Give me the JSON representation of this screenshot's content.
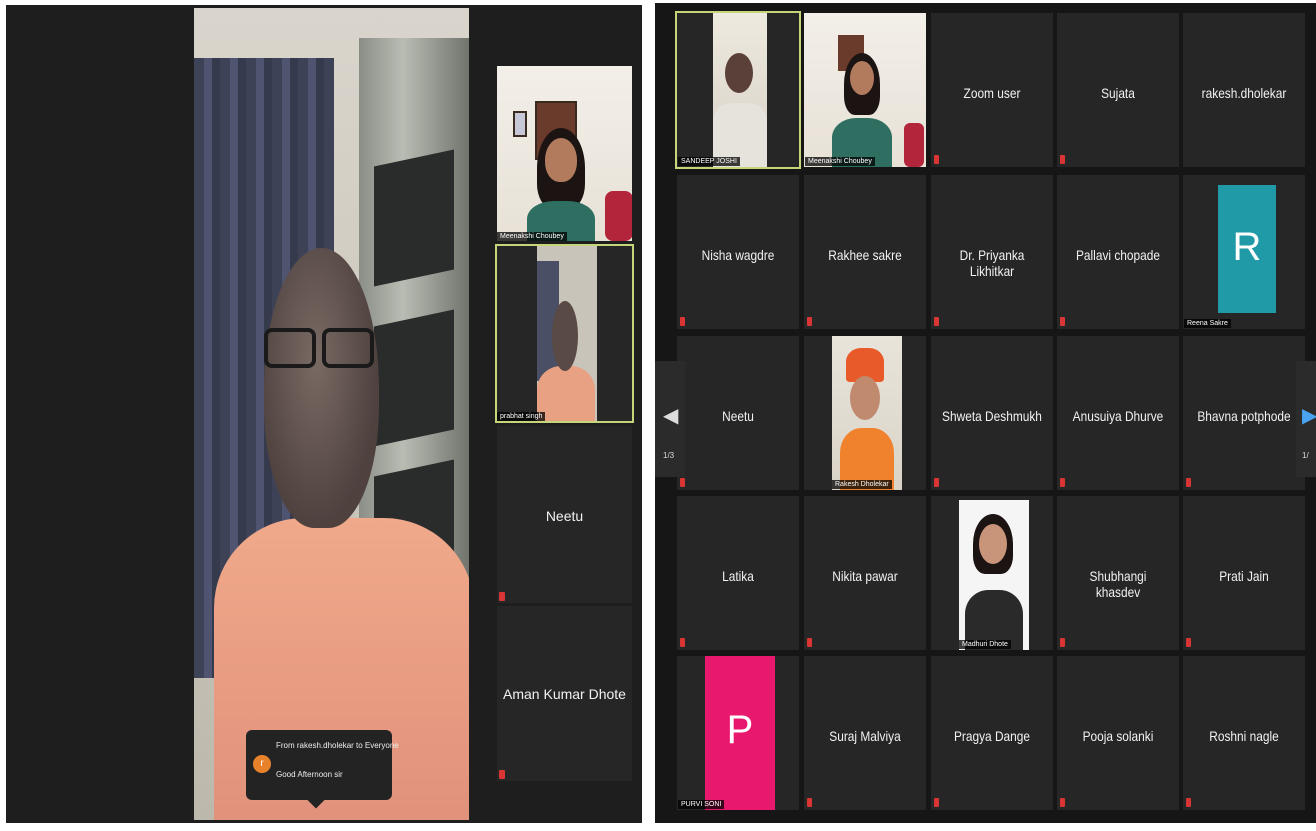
{
  "speaker_view": {
    "chat": {
      "avatar_letter": "r",
      "from": "From rakesh.dholekar to Everyone",
      "message": "Good Afternoon sir"
    },
    "side_tiles": [
      {
        "name": "Meenakshi Choubey",
        "video": true
      },
      {
        "name": "prabhat singh",
        "video": true,
        "active": true
      },
      {
        "name": "Neetu",
        "video": false,
        "muted": true
      },
      {
        "name": "Aman Kumar Dhote",
        "video": false,
        "muted": true
      }
    ]
  },
  "gallery_view": {
    "page_indicator_left": "1/3",
    "page_indicator_right": "1/",
    "tiles": [
      {
        "name": "SANDEEP JOSHI",
        "video": true,
        "active": true
      },
      {
        "name": "Meenakshi Choubey",
        "video": true
      },
      {
        "name": "Zoom user",
        "video": false,
        "muted": true
      },
      {
        "name": "Sujata",
        "video": false,
        "muted": true
      },
      {
        "name": "rakesh.dholekar",
        "video": false,
        "muted": false
      },
      {
        "name": "Nisha wagdre",
        "video": false,
        "muted": true
      },
      {
        "name": "Rakhee sakre",
        "video": false,
        "muted": true
      },
      {
        "name": "Dr. Priyanka Likhitkar",
        "video": false,
        "muted": true
      },
      {
        "name": "Pallavi chopade",
        "video": false,
        "muted": true
      },
      {
        "name": "Reena Sakre",
        "video": false,
        "avatar_letter": "R",
        "avatar_color": "#1f9aa6",
        "muted": true
      },
      {
        "name": "Neetu",
        "video": false,
        "muted": true
      },
      {
        "name": "Rakesh Dholekar",
        "video": true,
        "muted": true
      },
      {
        "name": "Shweta Deshmukh",
        "video": false,
        "muted": true
      },
      {
        "name": "Anusuiya Dhurve",
        "video": false,
        "muted": true
      },
      {
        "name": "Bhavna potphode",
        "video": false,
        "muted": true
      },
      {
        "name": "Latika",
        "video": false,
        "muted": true
      },
      {
        "name": "Nikita pawar",
        "video": false,
        "muted": true
      },
      {
        "name": "Madhuri Dhote",
        "video": true,
        "muted": true
      },
      {
        "name": "Shubhangi khasdev",
        "video": false,
        "muted": true
      },
      {
        "name": "Prati Jain",
        "video": false,
        "muted": true
      },
      {
        "name": "PURVI SONI",
        "video": false,
        "avatar_letter": "P",
        "avatar_color": "#e8186f",
        "muted": true
      },
      {
        "name": "Suraj Malviya",
        "video": false,
        "muted": true
      },
      {
        "name": "Pragya Dange",
        "video": false,
        "muted": true
      },
      {
        "name": "Pooja solanki",
        "video": false,
        "muted": true
      },
      {
        "name": "Roshni nagle",
        "video": false,
        "muted": true
      }
    ]
  }
}
